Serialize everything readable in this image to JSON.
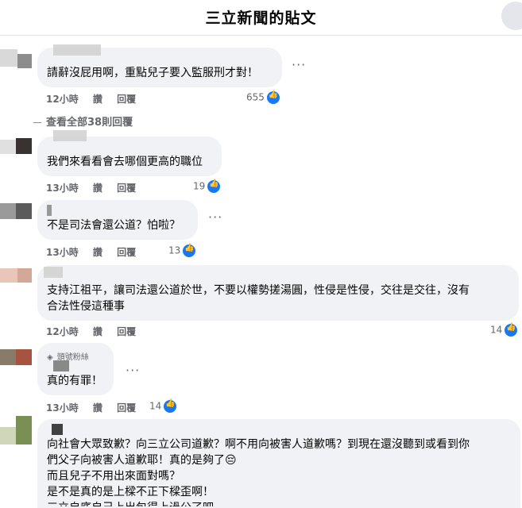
{
  "header": {
    "title": "三立新聞的貼文"
  },
  "comments": [
    {
      "text": "請辭沒屁用啊，重點兒子要入監服刑才對！",
      "time": "12小時",
      "like": "讚",
      "reply": "回覆",
      "likes": "655"
    },
    {
      "text": "我們來看看會去哪個更高的職位",
      "time": "13小時",
      "like": "讚",
      "reply": "回覆",
      "likes": "19"
    },
    {
      "text": "不是司法會還公道？怕啦？",
      "time": "13小時",
      "like": "讚",
      "reply": "回覆",
      "likes": "13"
    },
    {
      "text_line1": "支持江祖平，讓司法還公道於世，不要以權勢搓湯圓，性侵是性侵，交往是交往，沒有",
      "text_line2": "合法性侵這種事",
      "time": "12小時",
      "like": "讚",
      "reply": "回覆",
      "likes": "14"
    },
    {
      "badge": "頭號粉絲",
      "text": "真的有罪！",
      "time": "13小時",
      "like": "讚",
      "reply": "回覆",
      "likes": "14"
    },
    {
      "text_line1": "向社會大眾致歉？向三立公司道歉？啊不用向被害人道歉嗎？到現在還沒聽到或看到你",
      "text_line2": "們父子向被害人道歉耶！真的是夠了😔",
      "text_line3": "而且兒子不用出來面對嗎？",
      "text_line4": "是不是真的是上樑不正下樑歪啊！",
      "text_line5": "三立自底自己上出包得上過公了吧"
    }
  ],
  "view_replies": "查看全部38則回覆",
  "more_glyph": "···",
  "icons": {
    "like": "like-icon",
    "more": "more-icon",
    "close": "close-icon",
    "fan": "fan-badge-icon"
  },
  "colors": {
    "bubble": "#f0f2f5",
    "like_blue": "#1877f2",
    "meta_gray": "#65676b"
  }
}
